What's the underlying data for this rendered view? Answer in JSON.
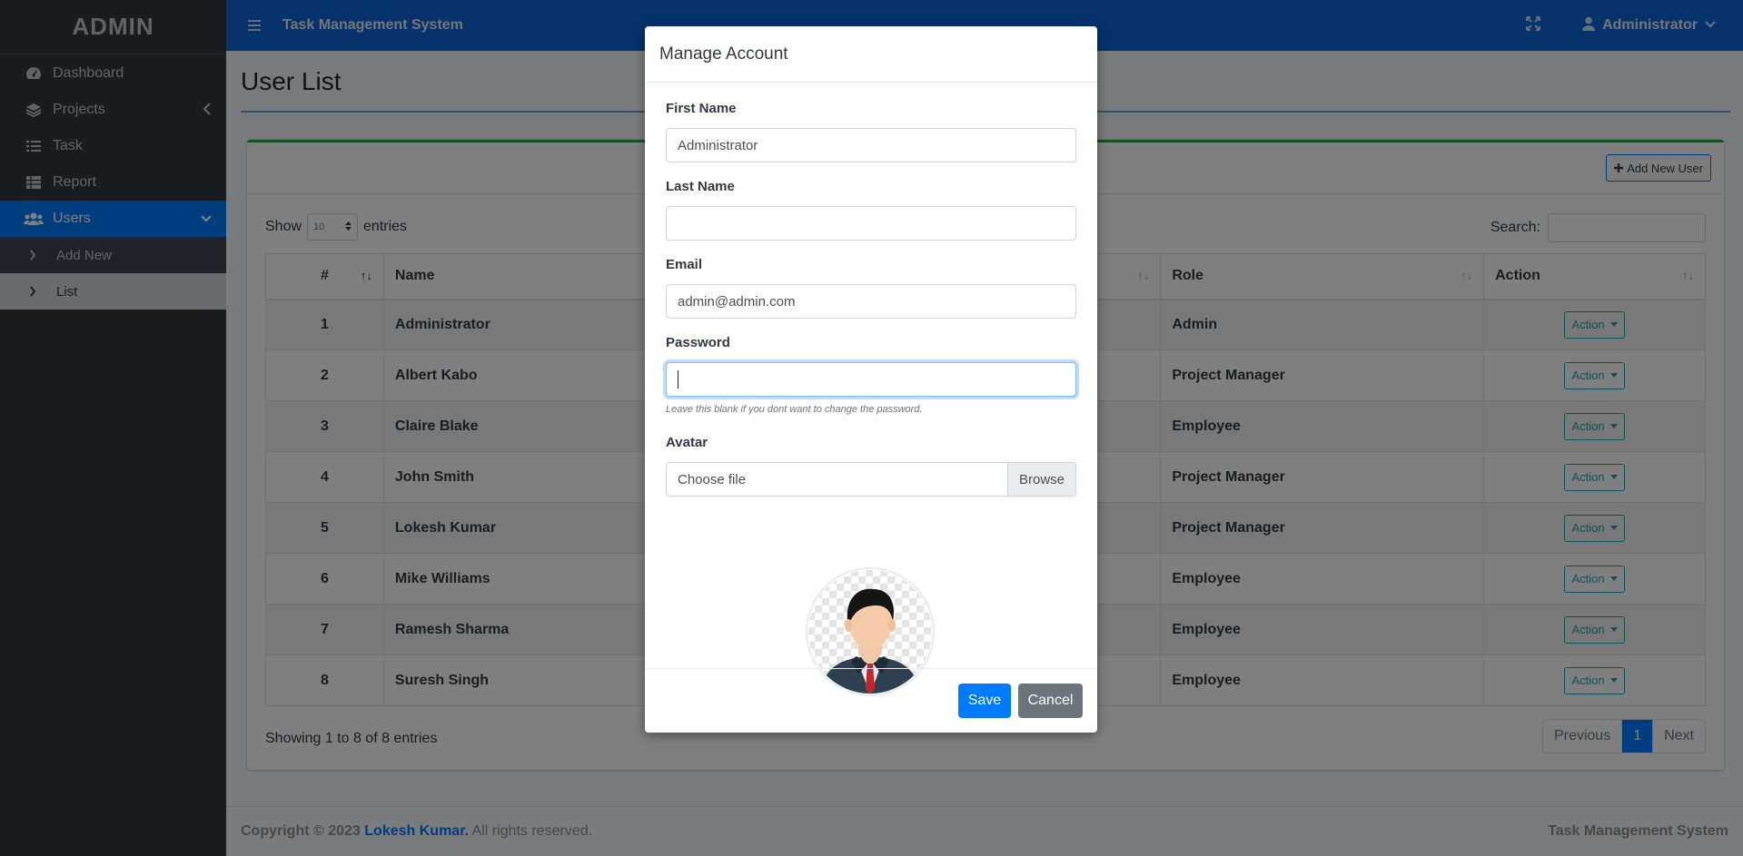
{
  "sidebar": {
    "brand": "ADMIN",
    "items": [
      {
        "label": "Dashboard",
        "icon": "dashboard-icon"
      },
      {
        "label": "Projects",
        "icon": "layers-icon"
      },
      {
        "label": "Task",
        "icon": "tasks-icon"
      },
      {
        "label": "Report",
        "icon": "table-icon"
      },
      {
        "label": "Users",
        "icon": "users-icon"
      }
    ],
    "sub_items": [
      {
        "label": "Add New"
      },
      {
        "label": "List"
      }
    ]
  },
  "topbar": {
    "title": "Task Management System",
    "user": "Administrator"
  },
  "page": {
    "title": "User List",
    "add_button": "Add New User",
    "show_label": "Show",
    "entries_label": "entries",
    "length_value": "10",
    "search_label": "Search:",
    "columns": [
      "#",
      "Name",
      "Role",
      "Action"
    ],
    "rows": [
      {
        "num": "1",
        "name": "Administrator",
        "role": "Admin",
        "action": "Action"
      },
      {
        "num": "2",
        "name": "Albert Kabo",
        "role": "Project Manager",
        "action": "Action"
      },
      {
        "num": "3",
        "name": "Claire Blake",
        "role": "Employee",
        "action": "Action"
      },
      {
        "num": "4",
        "name": "John Smith",
        "role": "Project Manager",
        "action": "Action"
      },
      {
        "num": "5",
        "name": "Lokesh Kumar",
        "role": "Project Manager",
        "action": "Action"
      },
      {
        "num": "6",
        "name": "Mike Williams",
        "role": "Employee",
        "action": "Action"
      },
      {
        "num": "7",
        "name": "Ramesh Sharma",
        "role": "Employee",
        "action": "Action"
      },
      {
        "num": "8",
        "name": "Suresh Singh",
        "role": "Employee",
        "action": "Action"
      }
    ],
    "info": "Showing 1 to 8 of 8 entries",
    "pager": {
      "prev": "Previous",
      "current": "1",
      "next": "Next"
    }
  },
  "footer": {
    "prefix": "Copyright © 2023",
    "author": "Lokesh Kumar.",
    "suffix": "All rights reserved.",
    "right": "Task Management System"
  },
  "modal": {
    "title": "Manage Account",
    "first_name_label": "First Name",
    "first_name_value": "Administrator",
    "last_name_label": "Last Name",
    "last_name_value": "",
    "email_label": "Email",
    "email_value": "admin@admin.com",
    "password_label": "Password",
    "password_hint": "Leave this blank if you dont want to change the password.",
    "avatar_label": "Avatar",
    "file_placeholder": "Choose file",
    "browse_label": "Browse",
    "save_label": "Save",
    "cancel_label": "Cancel"
  }
}
